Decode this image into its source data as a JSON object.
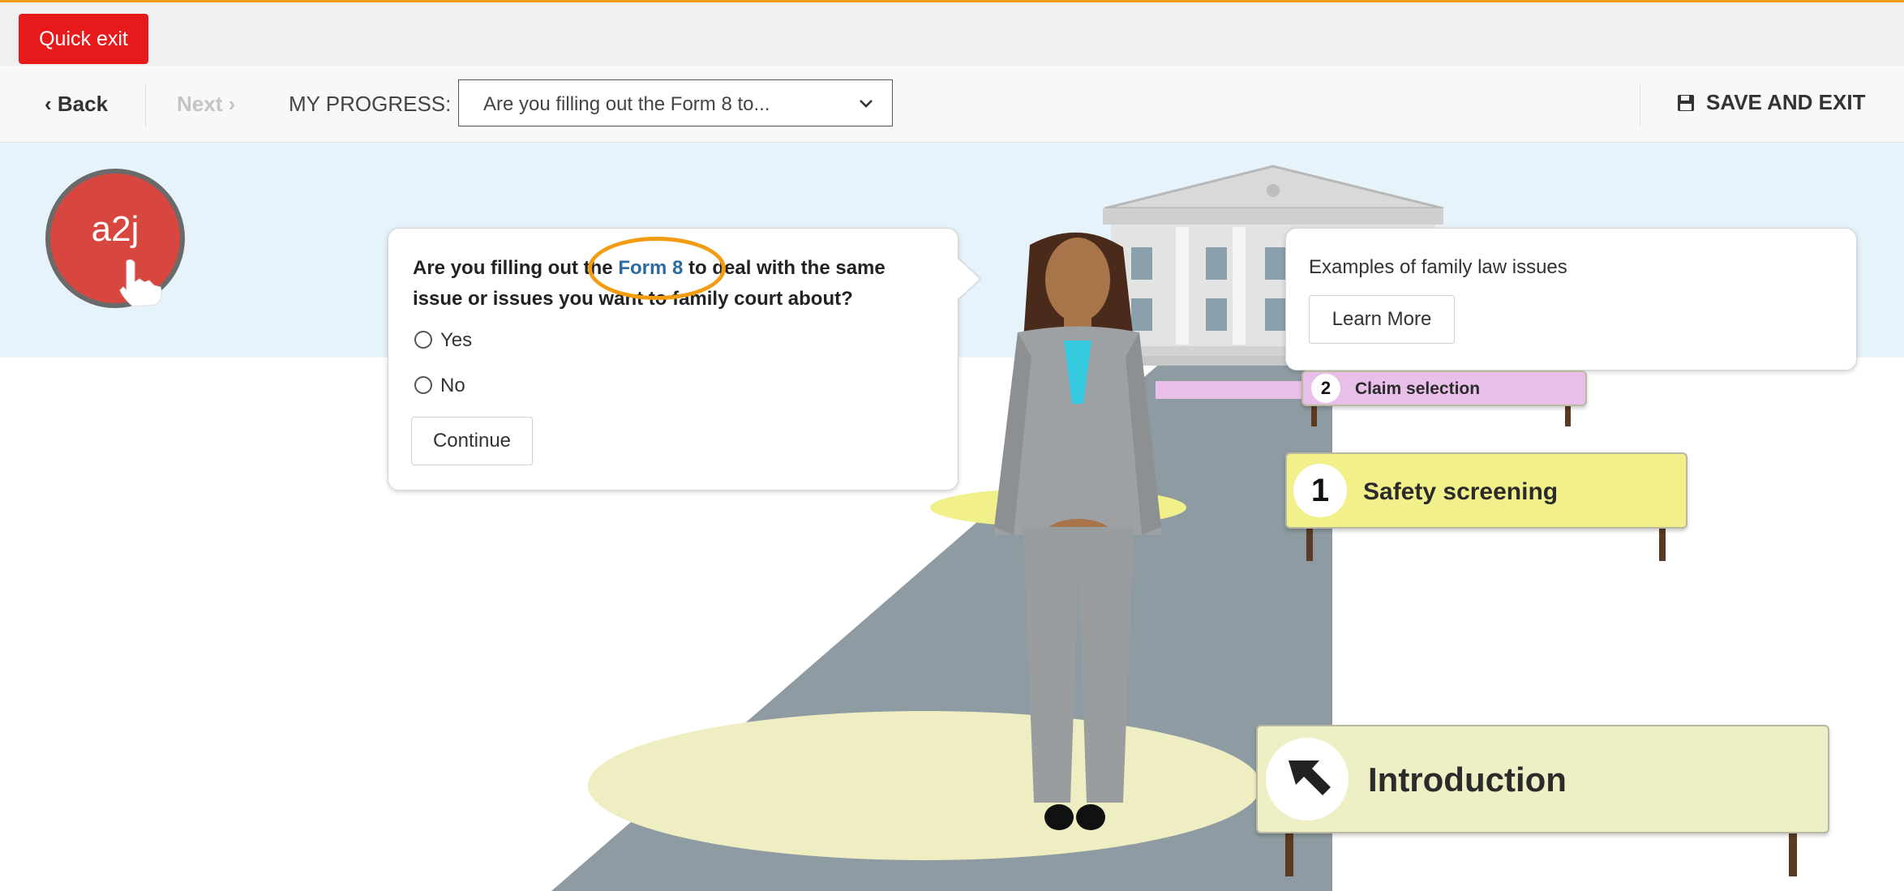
{
  "header": {
    "quick_exit": "Quick exit",
    "back": "‹ Back",
    "next": "Next ›",
    "progress_label": "MY PROGRESS:",
    "progress_value": "Are you filling out the Form 8 to...",
    "save_exit": "SAVE AND EXIT"
  },
  "logo": {
    "text": "a2j"
  },
  "question": {
    "text_before": "Are you filling out the ",
    "link": "Form 8",
    "text_after": " to deal with the same issue or issues you want to family court about?",
    "options": [
      "Yes",
      "No"
    ],
    "continue": "Continue"
  },
  "info_box": {
    "text": "Examples of family law issues",
    "button": "Learn More"
  },
  "signs": {
    "step2": {
      "number": "2",
      "label": "Claim selection"
    },
    "step1": {
      "number": "1",
      "label": "Safety screening"
    },
    "intro": {
      "label": "Introduction"
    }
  },
  "colors": {
    "accent": "#f39c12",
    "quick_exit": "#e8191b",
    "link": "#2c6aa0",
    "sky": "#e6f3fa",
    "path": "#8f9ba2",
    "sign_intro": "#efefc5",
    "sign_step1": "#f1f08a",
    "sign_step2": "#e8bfe8"
  },
  "icons": {
    "save": "floppy-disk-icon",
    "select": "chevron-down-icon",
    "intro": "arrow-up-left-icon",
    "logo": "hand-pointer-icon"
  }
}
